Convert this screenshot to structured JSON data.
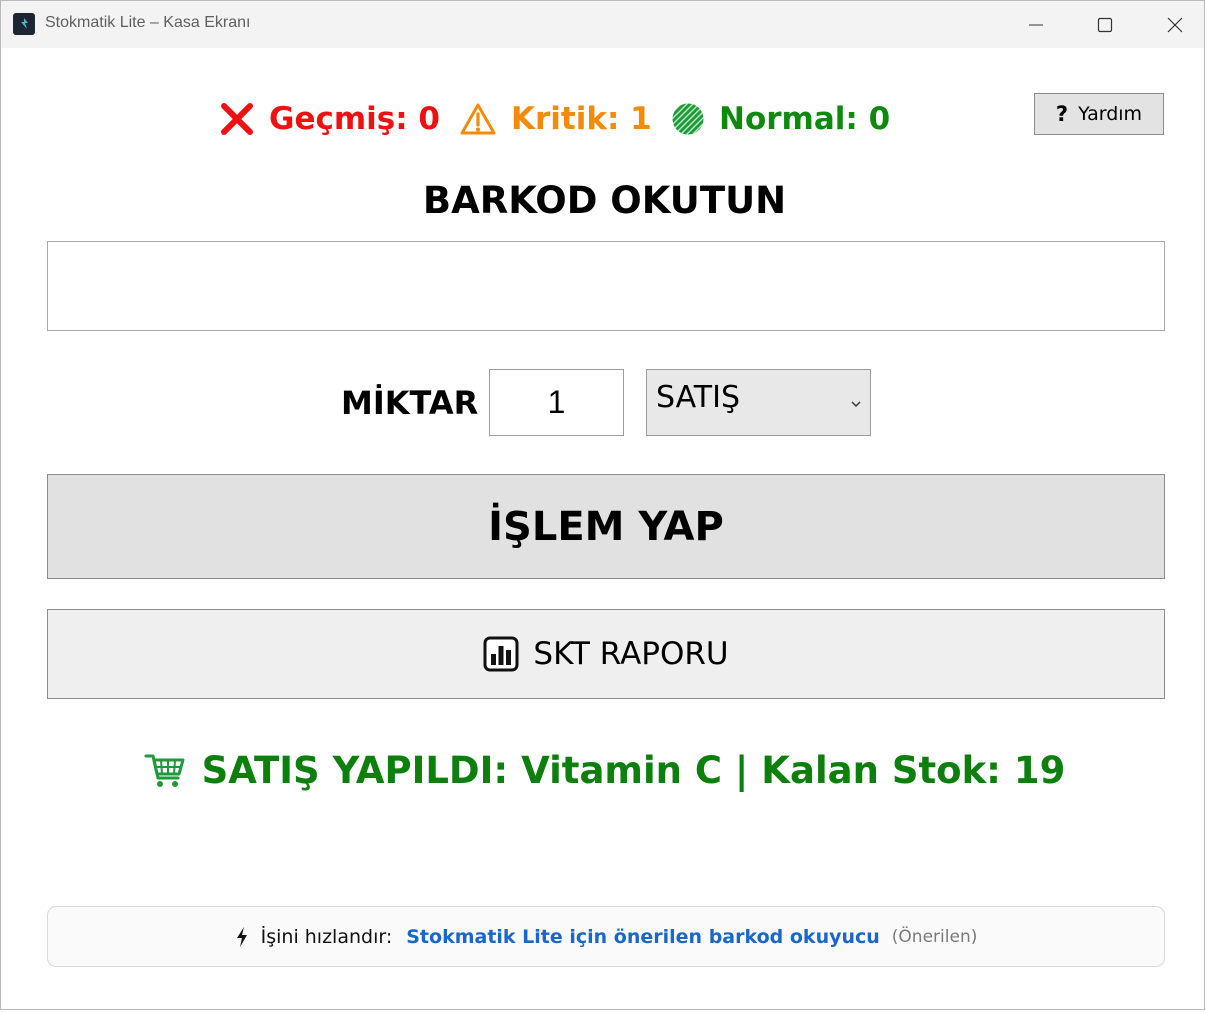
{
  "window": {
    "title": "Stokmatik Lite – Kasa Ekranı",
    "icons": {
      "app": "app-logo-icon",
      "minimize": "minimize-icon",
      "maximize": "maximize-icon",
      "close": "close-icon"
    }
  },
  "status": {
    "gecmis": {
      "text": "Geçmiş: 0",
      "icon": "red-x-icon",
      "color": "#ee1111"
    },
    "kritik": {
      "text": "Kritik: 1",
      "icon": "warning-triangle-icon",
      "color": "#f48a0c"
    },
    "normal": {
      "text": "Normal: 0",
      "icon": "green-circle-icon",
      "color": "#0d8a0d"
    }
  },
  "help": {
    "icon_text": "?",
    "label": "Yardım"
  },
  "barcode": {
    "title": "BARKOD OKUTUN",
    "value": ""
  },
  "quantity": {
    "label": "MİKTAR",
    "value": "1"
  },
  "mode_select": {
    "selected": "SATIŞ"
  },
  "buttons": {
    "process": "İŞLEM YAP",
    "report": "SKT RAPORU"
  },
  "result": {
    "text": "SATIŞ YAPILDI: Vitamin C | Kalan Stok: 19",
    "icon": "shopping-cart-icon",
    "color": "#0d7f0d"
  },
  "promo": {
    "lead": "İşini hızlandır:",
    "link": "Stokmatik Lite için önerilen barkod okuyucu",
    "tag": "(Önerilen)"
  }
}
